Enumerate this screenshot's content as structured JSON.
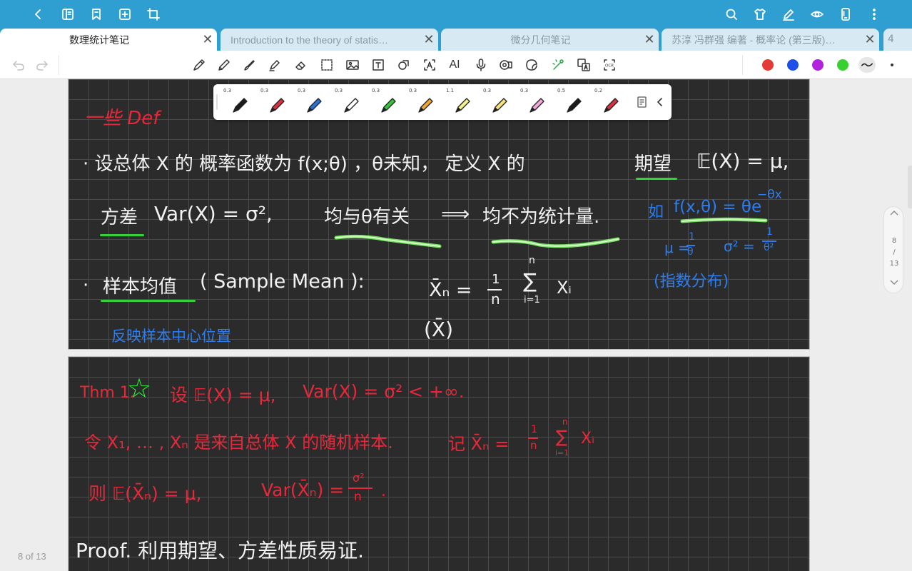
{
  "topbar": {
    "icons": [
      "back-icon",
      "sidebar-icon",
      "bookmark-icon",
      "add-page-icon",
      "crop-icon",
      "search-icon",
      "shirt-icon",
      "pen-edit-icon",
      "eye-icon",
      "phone-icon",
      "more-icon"
    ]
  },
  "tabs": [
    {
      "label": "数理统计笔记",
      "active": true
    },
    {
      "label": "Introduction to the theory of statis…",
      "active": false
    },
    {
      "label": "微分几何笔记",
      "active": false
    },
    {
      "label": "苏淳 冯群强 编著 - 概率论 (第三版)…",
      "active": false
    }
  ],
  "tab_count": "4",
  "toolbar": {
    "ai_label": "AI",
    "colors": [
      "#e53935",
      "#1e4fe8",
      "#b321de",
      "#36d12e"
    ]
  },
  "pen_palette": {
    "pens": [
      {
        "size": "0.3",
        "color": "#1a1a1a"
      },
      {
        "size": "0.3",
        "color": "#d8303c"
      },
      {
        "size": "0.3",
        "color": "#2d6fd6"
      },
      {
        "size": "0.3",
        "color": "#ffffff"
      },
      {
        "size": "0.3",
        "color": "#33c43b"
      },
      {
        "size": "0.3",
        "color": "#f2a531"
      },
      {
        "size": "1.1",
        "color": "#f4f08a"
      },
      {
        "size": "0.3",
        "color": "#f7e37a"
      },
      {
        "size": "0.3",
        "color": "#f2a8d6"
      },
      {
        "size": "0.5",
        "color": "#1a1a1a"
      },
      {
        "size": "0.2",
        "color": "#d8303c"
      }
    ]
  },
  "page1": {
    "heading": "一些 Def",
    "line1": "· 设总体 X 的 概率函数为 f(x;θ) ，θ未知， 定义 X 的",
    "expect_word": "期望",
    "expect_formula": "𝔼(X) = μ,",
    "variance_word": "方差",
    "variance_formula": "Var(X) = σ²,",
    "depends": "均与θ有关",
    "implies": "⟹",
    "not_stat": "均不为统计量.",
    "example_label": "如",
    "example_f": "f(x,θ) = θe",
    "example_exp": "−θx",
    "mu_eq": "μ =",
    "mu_num": "1",
    "mu_den": "θ",
    "sigma_eq": "σ² =",
    "sigma_num": "1",
    "sigma_den": "θ²",
    "exp_dist": "(指数分布)",
    "bullet2": "·",
    "sample_mean_word": "样本均值",
    "sample_mean_en": "( Sample  Mean ):",
    "xbar_n": "X̄ₙ =",
    "frac_num": "1",
    "frac_den": "n",
    "sum_top": "n",
    "sum_sym": "∑",
    "sum_bottom": "i=1",
    "sum_var": "Xᵢ",
    "xbar_alt": "(X̄)",
    "reflects": "反映样本中心位置"
  },
  "page2": {
    "thm_label": "Thm 1.",
    "thm_star": "☆",
    "thm_cond1": "设 𝔼(X) = μ,",
    "thm_cond2": "Var(X) = σ² < +∞.",
    "line2a": "令 X₁, … , Xₙ 是来自总体 X 的随机样本.",
    "line2b": "记 X̄ₙ =",
    "line2_num": "1",
    "line2_den": "n",
    "line2_sum": "∑",
    "line2_top": "n",
    "line2_bot": "i=1",
    "line2_var": "Xᵢ",
    "line3a": "则 𝔼(X̄ₙ) = μ,",
    "line3b": "Var(X̄ₙ) =",
    "line3_num": "σ²",
    "line3_den": "n",
    "line3_end": ".",
    "proof": "Proof.  利用期望、方差性质易证."
  },
  "page_nav": {
    "current": "8",
    "sep": "/",
    "total": "13"
  },
  "page_counter": "8 of 13"
}
